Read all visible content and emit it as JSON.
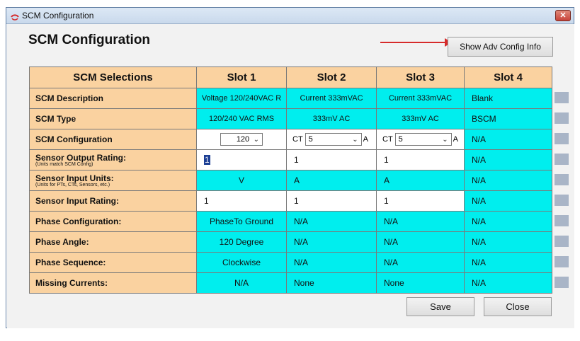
{
  "window": {
    "title": "SCM Configuration",
    "close_glyph": "✕"
  },
  "page": {
    "heading": "SCM Configuration",
    "adv_button": "Show Adv Config Info",
    "save_button": "Save",
    "close_button": "Close"
  },
  "table": {
    "headers": [
      "SCM Selections",
      "Slot 1",
      "Slot 2",
      "Slot 3",
      "Slot 4"
    ],
    "rows": {
      "description": {
        "label": "SCM Description",
        "slot1": "Voltage 120/240VAC R",
        "slot2": "Current 333mVAC",
        "slot3": "Current 333mVAC",
        "slot4": "Blank"
      },
      "type": {
        "label": "SCM Type",
        "slot1": "120/240 VAC RMS",
        "slot2": "333mV AC",
        "slot3": "333mV AC",
        "slot4": "BSCM"
      },
      "configuration": {
        "label": "SCM Configuration",
        "slot1_select": "120",
        "slot2_prefix": "CT",
        "slot2_select": "5",
        "slot2_unit": "A",
        "slot3_prefix": "CT",
        "slot3_select": "5",
        "slot3_unit": "A",
        "slot4": "N/A"
      },
      "output_rating": {
        "label": "Sensor Output Rating:",
        "sub": "(Units match SCM Config)",
        "slot1": "1",
        "slot2": "1",
        "slot3": "1",
        "slot4": "N/A"
      },
      "input_units": {
        "label": "Sensor Input Units:",
        "sub": "(Units for PTs, CTs, Sensors, etc.)",
        "slot1": "V",
        "slot2": "A",
        "slot3": "A",
        "slot4": "N/A"
      },
      "input_rating": {
        "label": "Sensor Input Rating:",
        "slot1": "1",
        "slot2": "1",
        "slot3": "1",
        "slot4": "N/A"
      },
      "phase_config": {
        "label": "Phase Configuration:",
        "slot1": "PhaseTo Ground",
        "slot2": "N/A",
        "slot3": "N/A",
        "slot4": "N/A"
      },
      "phase_angle": {
        "label": "Phase Angle:",
        "slot1": "120 Degree",
        "slot2": "N/A",
        "slot3": "N/A",
        "slot4": "N/A"
      },
      "phase_sequence": {
        "label": "Phase Sequence:",
        "slot1": "Clockwise",
        "slot2": "N/A",
        "slot3": "N/A",
        "slot4": "N/A"
      },
      "missing_currents": {
        "label": "Missing Currents:",
        "slot1": "N/A",
        "slot2": "None",
        "slot3": "None",
        "slot4": "N/A"
      }
    }
  },
  "icons": {
    "app": "scm-logo-icon",
    "chevron": "chevron-down-icon",
    "arrow": "red-arrow-icon"
  },
  "colors": {
    "header_bg": "#fad2a0",
    "cell_cyan": "#00eeee",
    "arrow": "#d62b2b",
    "close_button": "#c8443a"
  }
}
